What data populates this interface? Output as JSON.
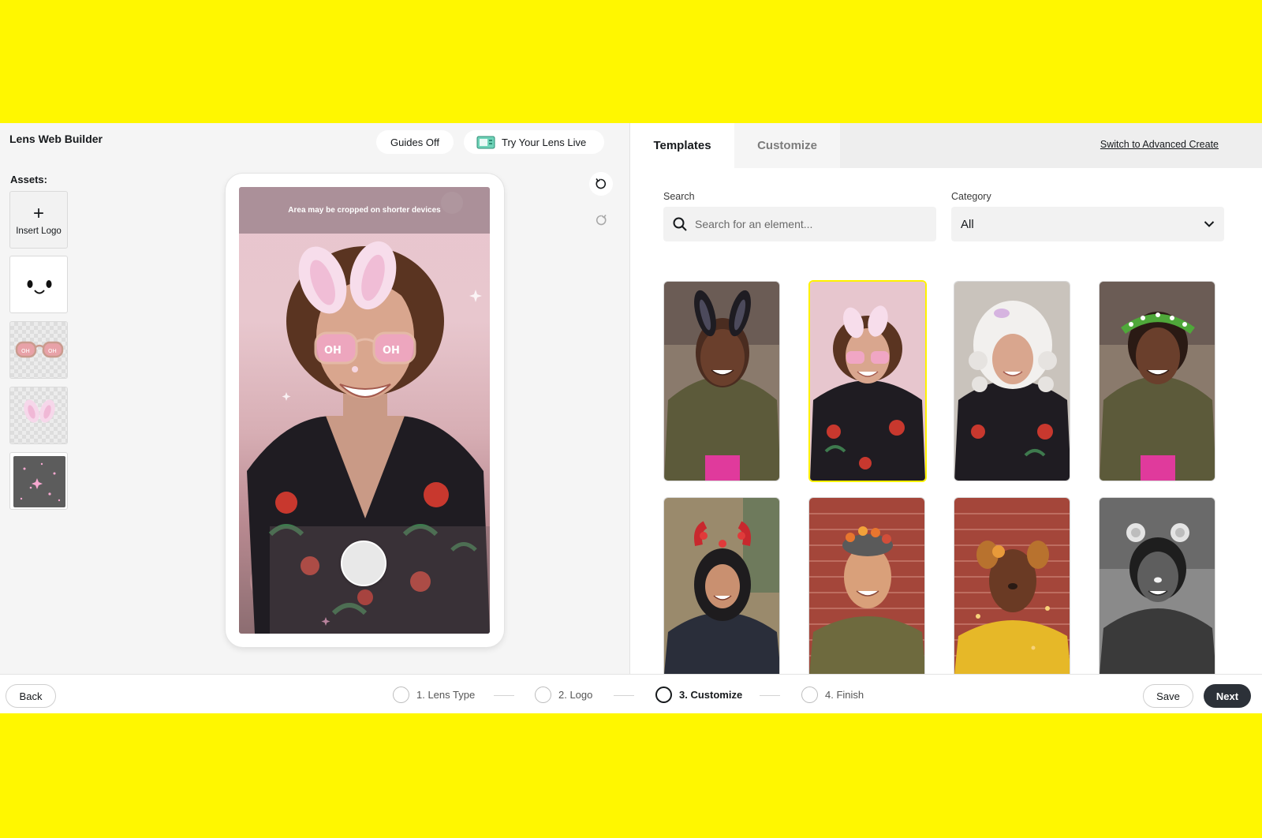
{
  "app": {
    "title": "Lens Web Builder"
  },
  "assets": {
    "label": "Assets:",
    "insert_logo": "Insert Logo",
    "items": [
      "face-asset",
      "glasses-asset",
      "bunny-ears-asset",
      "sparkles-asset"
    ]
  },
  "toolbar": {
    "guides_label": "Guides Off",
    "try_label": "Try Your Lens Live"
  },
  "preview": {
    "crop_notice": "Area may be cropped on shorter devices"
  },
  "panel": {
    "tabs": [
      {
        "label": "Templates",
        "active": true
      },
      {
        "label": "Customize",
        "active": false
      }
    ],
    "advanced_link": "Switch to Advanced Create",
    "search": {
      "label": "Search",
      "placeholder": "Search for an element..."
    },
    "category": {
      "label": "Category",
      "value": "All"
    },
    "templates": [
      {
        "name": "dark-bunny-ears"
      },
      {
        "name": "pink-bunny-ears",
        "selected": true
      },
      {
        "name": "white-wig"
      },
      {
        "name": "flower-crown"
      },
      {
        "name": "red-flower-horns"
      },
      {
        "name": "autumn-flower-crown"
      },
      {
        "name": "dog-ears"
      },
      {
        "name": "bear-ears-bw"
      }
    ]
  },
  "footer": {
    "back": "Back",
    "steps": [
      {
        "label": "1. Lens Type",
        "active": false
      },
      {
        "label": "2. Logo",
        "active": false
      },
      {
        "label": "3. Customize",
        "active": true
      },
      {
        "label": "4. Finish",
        "active": false
      }
    ],
    "save": "Save",
    "next": "Next"
  },
  "colors": {
    "brand_yellow": "#FFF700",
    "dark_button": "#2C3138",
    "selected_border": "#FFF200"
  }
}
